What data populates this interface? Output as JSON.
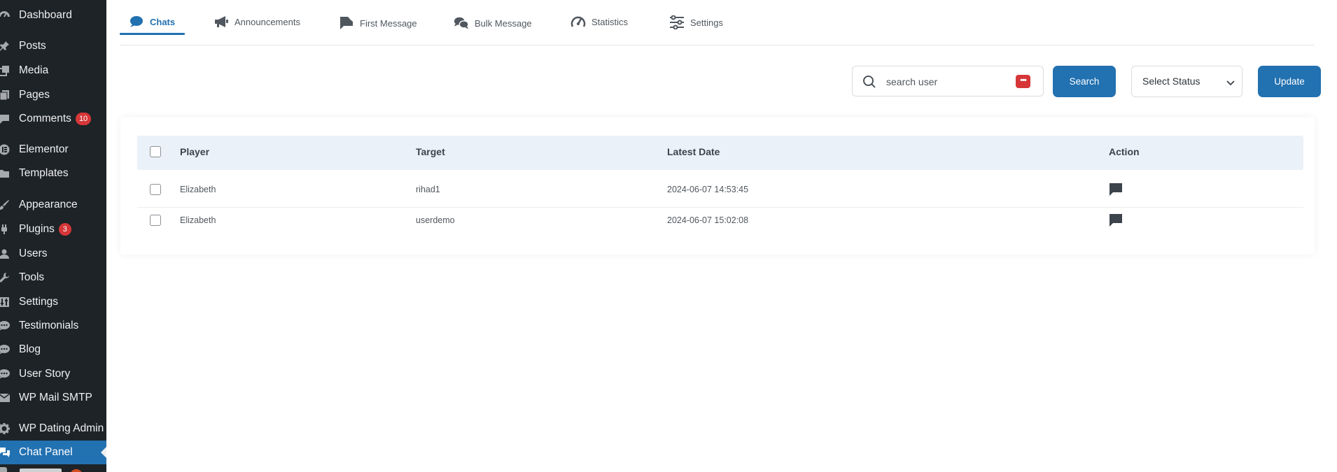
{
  "sidebar": {
    "items": [
      {
        "label": "Dashboard",
        "icon": "dashboard-icon"
      },
      {
        "label": "Posts",
        "icon": "pushpin-icon"
      },
      {
        "label": "Media",
        "icon": "media-icon"
      },
      {
        "label": "Pages",
        "icon": "pages-icon"
      },
      {
        "label": "Comments",
        "icon": "comment-icon",
        "badge": "10"
      },
      {
        "label": "Elementor",
        "icon": "elementor-icon"
      },
      {
        "label": "Templates",
        "icon": "folder-icon"
      },
      {
        "label": "Appearance",
        "icon": "brush-icon"
      },
      {
        "label": "Plugins",
        "icon": "plugin-icon",
        "badge": "3"
      },
      {
        "label": "Users",
        "icon": "user-icon"
      },
      {
        "label": "Tools",
        "icon": "wrench-icon"
      },
      {
        "label": "Settings",
        "icon": "settings-icon"
      },
      {
        "label": "Testimonials",
        "icon": "speech-bubble-icon"
      },
      {
        "label": "Blog",
        "icon": "speech-bubble-icon"
      },
      {
        "label": "User Story",
        "icon": "speech-bubble-icon"
      },
      {
        "label": "WP Mail SMTP",
        "icon": "mail-icon"
      },
      {
        "label": "WP Dating Admin",
        "icon": "gear-icon"
      },
      {
        "label": "Chat Panel",
        "icon": "chat-bubbles-icon",
        "active": true
      }
    ],
    "colors": {
      "background": "#1d2327",
      "active": "#2271b1",
      "badge": "#d63638"
    }
  },
  "tabs": [
    {
      "label": "Chats",
      "icon": "chat-bubble-icon",
      "active": true
    },
    {
      "label": "Announcements",
      "icon": "megaphone-icon"
    },
    {
      "label": "First Message",
      "icon": "message-flag-icon"
    },
    {
      "label": "Bulk Message",
      "icon": "bulk-chat-icon"
    },
    {
      "label": "Statistics",
      "icon": "gauge-icon"
    },
    {
      "label": "Settings",
      "icon": "sliders-icon"
    }
  ],
  "toolbar": {
    "search_placeholder": "search user",
    "search_button": "Search",
    "status_select": "Select Status",
    "update_button": "Update"
  },
  "table": {
    "columns": [
      "Player",
      "Target",
      "Latest Date",
      "Action"
    ],
    "rows": [
      {
        "player": "Elizabeth",
        "target": "rihad1",
        "latest_date": "2024-06-07 14:53:45",
        "action_icon": "message-icon"
      },
      {
        "player": "Elizabeth",
        "target": "userdemo",
        "latest_date": "2024-06-07 15:02:08",
        "action_icon": "message-icon"
      }
    ]
  },
  "colors": {
    "accent": "#2271b1",
    "header_bg": "#ebf1f8"
  }
}
